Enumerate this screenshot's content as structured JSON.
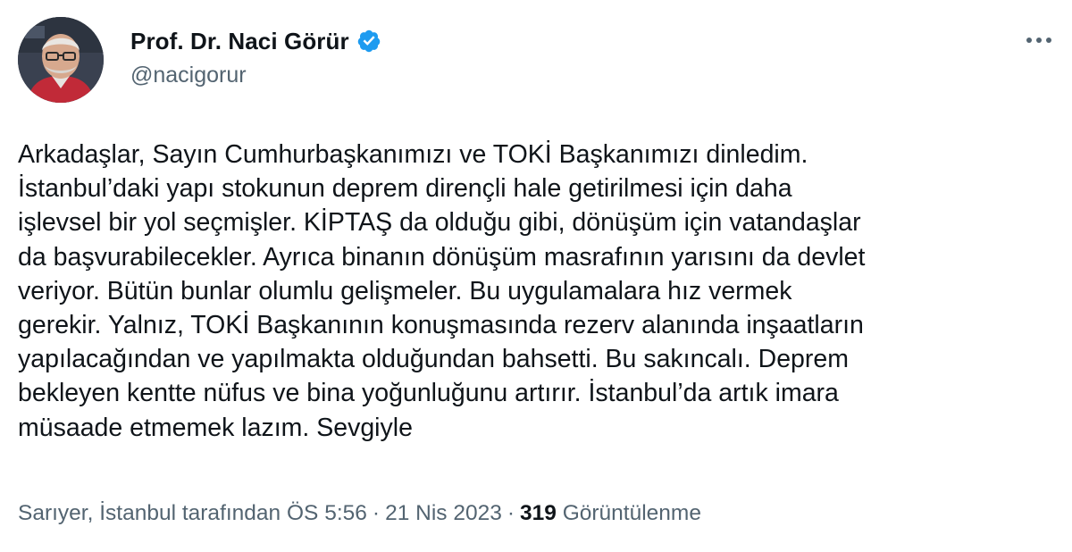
{
  "author": {
    "display_name": "Prof. Dr. Naci Görür",
    "handle": "@nacigorur",
    "verified_icon": "verified-badge-icon",
    "verified_color": "#1d9bf0"
  },
  "more_icon": "more-horizontal-icon",
  "tweet": {
    "lines": [
      "Arkadaşlar, Sayın Cumhurbaşkanımızı ve TOKİ Başkanımızı dinledim.",
      "İstanbul’daki yapı stokunun deprem dirençli hale getirilmesi için daha",
      "işlevsel bir yol seçmişler. KİPTAŞ da olduğu gibi, dönüşüm için vatandaşlar",
      "da başvurabilecekler. Ayrıca binanın dönüşüm masrafının yarısını da devlet",
      "veriyor. Bütün bunlar olumlu gelişmeler. Bu uygulamalara hız vermek",
      "gerekir. Yalnız, TOKİ Başkanının konuşmasında rezerv alanında inşaatların",
      "yapılacağından ve yapılmakta olduğundan bahsetti. Bu sakıncalı. Deprem",
      "bekleyen kentte nüfus ve bina yoğunluğunu artırır. İstanbul’da artık imara",
      "müsaade etmemek lazım. Sevgiyle"
    ]
  },
  "meta": {
    "location": "Sarıyer, İstanbul tarafından",
    "time": "ÖS 5:56",
    "separator": "·",
    "date": "21 Nis 2023",
    "views_count": "319",
    "views_label": "Görüntülenme"
  },
  "colors": {
    "text_primary": "#0f1419",
    "text_secondary": "#536471",
    "accent": "#1d9bf0"
  }
}
